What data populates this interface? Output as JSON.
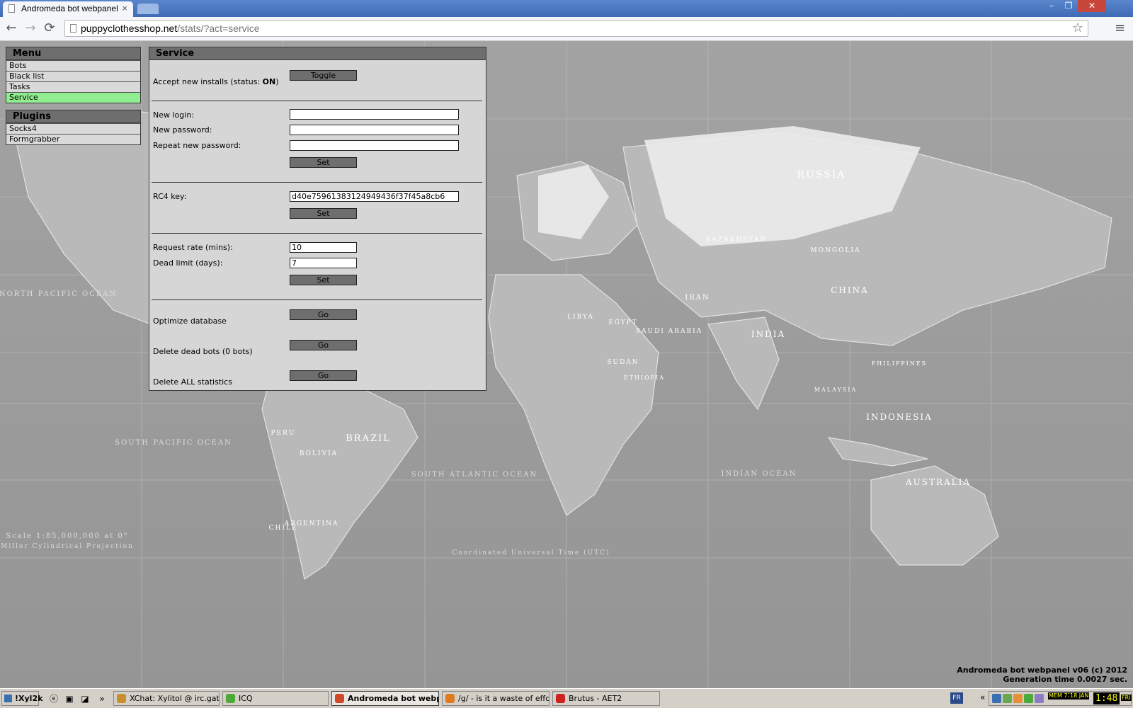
{
  "browser": {
    "tab_title": "Andromeda bot webpanel",
    "tab_close": "×",
    "url_host": "puppyclothesshop.net",
    "url_path": "/stats/?act=service",
    "back": "←",
    "forward": "→",
    "reload": "⟳",
    "star": "☆",
    "menu": "≡",
    "minimize": "–",
    "maximize": "❐",
    "close": "✕"
  },
  "menu": {
    "title": "Menu",
    "items": [
      {
        "label": "Bots",
        "active": false
      },
      {
        "label": "Black list",
        "active": false
      },
      {
        "label": "Tasks",
        "active": false
      },
      {
        "label": "Service",
        "active": true
      }
    ]
  },
  "plugins": {
    "title": "Plugins",
    "items": [
      {
        "label": "Socks4"
      },
      {
        "label": "Formgrabber"
      }
    ]
  },
  "service": {
    "title": "Service",
    "installs_label_prefix": "Accept new installs (status: ",
    "installs_status": "ON",
    "installs_label_suffix": ")",
    "toggle_label": "Toggle",
    "new_login_label": "New login:",
    "new_login_value": "",
    "new_password_label": "New password:",
    "new_password_value": "",
    "repeat_password_label": "Repeat new password:",
    "repeat_password_value": "",
    "set_label": "Set",
    "rc4_label": "RC4 key:",
    "rc4_value": "d40e75961383124949436f37f45a8cb6",
    "request_rate_label": "Request rate (mins):",
    "request_rate_value": "10",
    "dead_limit_label": "Dead limit (days):",
    "dead_limit_value": "7",
    "optimize_label": "Optimize database",
    "delete_dead_label": "Delete dead bots (0 bots)",
    "delete_all_label": "Delete ALL statistics",
    "go_label": "Go"
  },
  "map_labels": [
    "RUSSIA",
    "CHINA",
    "MONGOLIA",
    "KAZAKHSTAN",
    "IRAN",
    "SAUDI ARABIA",
    "INDIA",
    "SUDAN",
    "ETHIOPIA",
    "LIBYA",
    "EGYPT",
    "BRAZIL",
    "PERU",
    "BOLIVIA",
    "ARGENTINA",
    "CHILE",
    "INDONESIA",
    "AUSTRALIA",
    "PHILIPPINES",
    "MALAYSIA",
    "NORTH PACIFIC OCEAN",
    "SOUTH PACIFIC OCEAN",
    "SOUTH ATLANTIC OCEAN",
    "INDIAN OCEAN",
    "Scale 1:85,000,000 at 0°",
    "Miller Cylindrical Projection",
    "Coordinated Universal Time (UTC)"
  ],
  "footer": {
    "line1": "Andromeda bot webpanel v06 (c) 2012",
    "line2": "Generation time 0.0027 sec."
  },
  "taskbar": {
    "start_label": "!Xyl2k",
    "more": "»",
    "tasks": [
      {
        "label": "XChat: Xylitol @ irc.gate...",
        "icon_color": "#c8902a",
        "active": false
      },
      {
        "label": "ICQ",
        "icon_color": "#4caa3a",
        "active": false
      },
      {
        "label": "Andromeda bot webp...",
        "icon_color": "#d04a2a",
        "active": true
      },
      {
        "label": "/g/ - is it a waste of effo...",
        "icon_color": "#e07a20",
        "active": false
      },
      {
        "label": "Brutus - AET2",
        "icon_color": "#cc2222",
        "active": false
      }
    ],
    "lang": "FR",
    "tray_chevron": "«",
    "mem": "MEM 77%",
    "date": "18 JAN",
    "clock": "1:48",
    "ampm": "FRI"
  }
}
